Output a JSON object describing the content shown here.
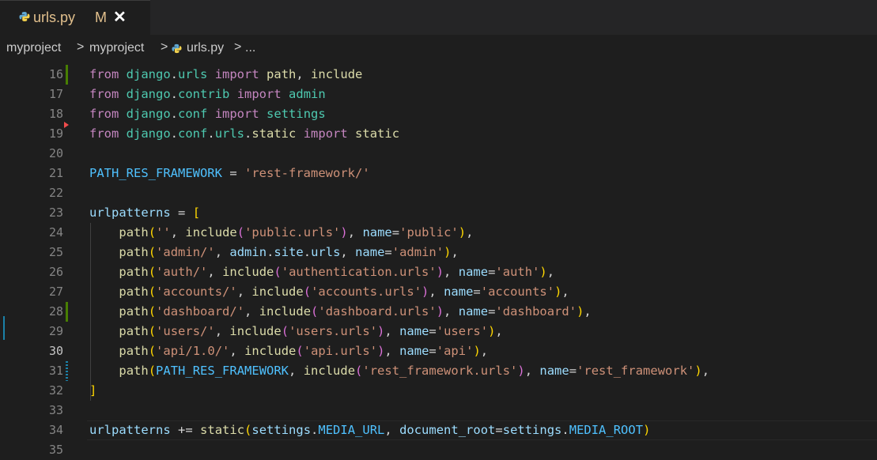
{
  "tab": {
    "file_icon": "python-icon",
    "filename": "urls.py",
    "modified": "M",
    "close": "✕"
  },
  "breadcrumb": {
    "items": [
      "myproject",
      "myproject",
      "urls.py",
      "..."
    ],
    "separator": ">",
    "file_icon": "python-icon"
  },
  "colors": {
    "background": "#1e1e1e",
    "keyword": "#c586c0",
    "string": "#ce9178",
    "function": "#dcdcaa",
    "variable": "#9cdcfe",
    "constant": "#4fc1ff",
    "git_added": "#487e02",
    "git_modified": "#1b81a8",
    "git_deleted": "#f14c4c"
  },
  "editor": {
    "active_line": 30,
    "lines": [
      {
        "n": "16",
        "code": "from django.urls import path, include"
      },
      {
        "n": "17",
        "code": "from django.contrib import admin"
      },
      {
        "n": "18",
        "code": "from django.conf import settings"
      },
      {
        "n": "19",
        "code": "from django.conf.urls.static import static"
      },
      {
        "n": "20",
        "code": ""
      },
      {
        "n": "21",
        "code": "PATH_RES_FRAMEWORK = 'rest-framework/'"
      },
      {
        "n": "22",
        "code": ""
      },
      {
        "n": "23",
        "code": "urlpatterns = ["
      },
      {
        "n": "24",
        "code": "    path('', include('public.urls'), name='public'),"
      },
      {
        "n": "25",
        "code": "    path('admin/', admin.site.urls, name='admin'),"
      },
      {
        "n": "26",
        "code": "    path('auth/', include('authentication.urls'), name='auth'),"
      },
      {
        "n": "27",
        "code": "    path('accounts/', include('accounts.urls'), name='accounts'),"
      },
      {
        "n": "28",
        "code": "    path('dashboard/', include('dashboard.urls'), name='dashboard'),"
      },
      {
        "n": "29",
        "code": "    path('users/', include('users.urls'), name='users'),"
      },
      {
        "n": "30",
        "code": "    path('api/1.0/', include('api.urls'), name='api'),"
      },
      {
        "n": "31",
        "code": "    path(PATH_RES_FRAMEWORK, include('rest_framework.urls'), name='rest_framework'),"
      },
      {
        "n": "32",
        "code": "]"
      },
      {
        "n": "33",
        "code": ""
      },
      {
        "n": "34",
        "code": "urlpatterns += static(settings.MEDIA_URL, document_root=settings.MEDIA_ROOT)"
      },
      {
        "n": "35",
        "code": ""
      }
    ]
  }
}
